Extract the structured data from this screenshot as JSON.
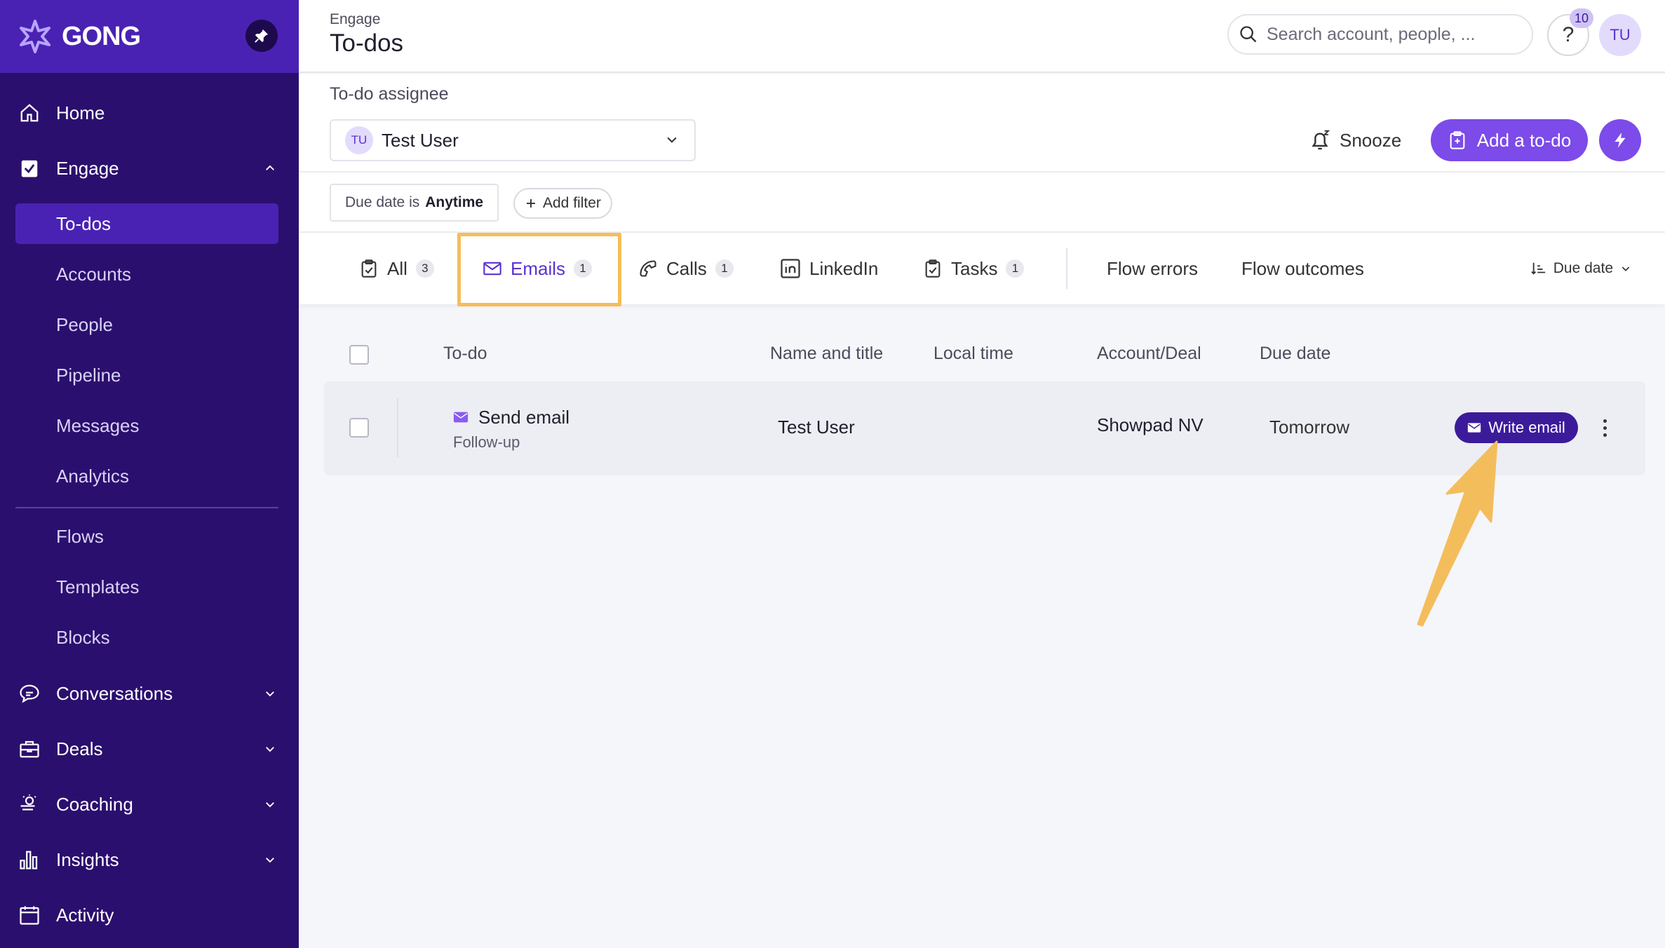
{
  "sidebar": {
    "logo": "GONG",
    "main": [
      {
        "label": "Home",
        "icon": "home-icon"
      },
      {
        "label": "Engage",
        "icon": "engage-icon"
      }
    ],
    "engage_items": [
      "To-dos",
      "Accounts",
      "People",
      "Pipeline",
      "Messages",
      "Analytics"
    ],
    "engage_items2": [
      "Flows",
      "Templates",
      "Blocks"
    ],
    "sections": [
      {
        "label": "Conversations",
        "icon": "conversations-icon"
      },
      {
        "label": "Deals",
        "icon": "deals-icon"
      },
      {
        "label": "Coaching",
        "icon": "coaching-icon"
      },
      {
        "label": "Insights",
        "icon": "insights-icon"
      },
      {
        "label": "Activity",
        "icon": "activity-icon"
      }
    ]
  },
  "header": {
    "breadcrumb": "Engage",
    "title": "To-dos",
    "search_placeholder": "Search account, people, ...",
    "help": "?",
    "notification_count": "10",
    "avatar": "TU"
  },
  "filters": {
    "assignee_label": "To-do assignee",
    "assignee_initials": "TU",
    "assignee_name": "Test User",
    "snooze": "Snooze",
    "add_todo": "Add a to-do",
    "due_prefix": "Due date is",
    "due_value": "Anytime",
    "add_filter": "Add filter"
  },
  "tabs": [
    {
      "label": "All",
      "count": "3"
    },
    {
      "label": "Emails",
      "count": "1"
    },
    {
      "label": "Calls",
      "count": "1"
    },
    {
      "label": "LinkedIn",
      "count": ""
    },
    {
      "label": "Tasks",
      "count": "1"
    },
    {
      "label": "Flow errors",
      "count": ""
    },
    {
      "label": "Flow outcomes",
      "count": ""
    }
  ],
  "sort_label": "Due date",
  "table": {
    "headers": [
      "To-do",
      "Name and title",
      "Local time",
      "Account/Deal",
      "Due date"
    ],
    "rows": [
      {
        "todo": "Send email",
        "subtitle": "Follow-up",
        "name": "Test User",
        "local_time": "",
        "account": "Showpad NV",
        "due": "Tomorrow",
        "action": "Write email"
      }
    ]
  },
  "colors": {
    "sidebar": "#2b0f6e",
    "accent": "#7c4be9",
    "highlight": "#f4bd5b",
    "dark_button": "#3c1b9b"
  }
}
